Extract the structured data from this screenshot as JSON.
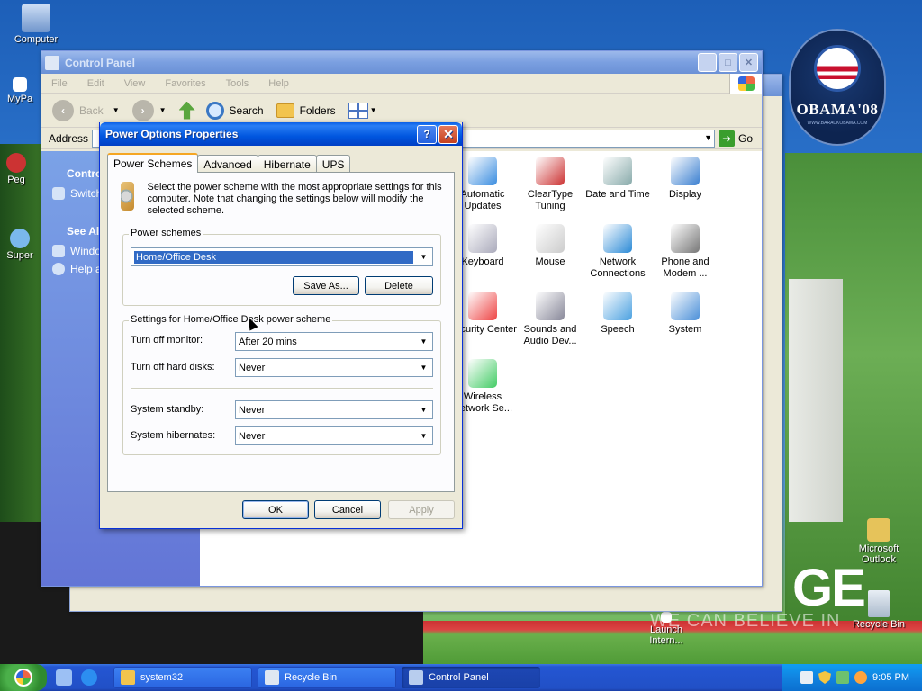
{
  "desktop": {
    "icons_left": [
      {
        "label": "Computer"
      },
      {
        "label": "MyPa"
      },
      {
        "label": "Peg"
      },
      {
        "label": "Super"
      }
    ],
    "icons_right": [
      {
        "label": "Microsoft Outlook"
      },
      {
        "label": "Recycle Bin"
      },
      {
        "label": "Launch Intern..."
      }
    ],
    "badge": {
      "text": "OBAMA'08",
      "sub": "WWW.BARACKOBAMA.COM"
    },
    "slogan_big": "GE",
    "slogan": "WE CAN BELIEVE IN"
  },
  "control_panel": {
    "title": "Control Panel",
    "menu": [
      "File",
      "Edit",
      "View",
      "Favorites",
      "Tools",
      "Help"
    ],
    "toolbar": {
      "back": "Back",
      "search": "Search",
      "folders": "Folders"
    },
    "address_label": "Address",
    "go_label": "Go",
    "sidebar": {
      "section1": "Contro",
      "link1": "Switch",
      "section2": "See Also",
      "link2": "Windo",
      "link3": "Help ar"
    },
    "icons": [
      {
        "label": "Automatic Updates",
        "color": "#3a8de0"
      },
      {
        "label": "ClearType Tuning",
        "color": "#c33"
      },
      {
        "label": "Date and Time",
        "color": "#8aa"
      },
      {
        "label": "Display",
        "color": "#3a7fd0"
      },
      {
        "label": "Keyboard",
        "color": "#aab"
      },
      {
        "label": "Mouse",
        "color": "#ccc"
      },
      {
        "label": "Network Connections",
        "color": "#2b8ad6"
      },
      {
        "label": "Phone and Modem ...",
        "color": "#777"
      },
      {
        "label": "Security Center",
        "color": "#e44"
      },
      {
        "label": "Sounds and Audio Dev...",
        "color": "#889"
      },
      {
        "label": "Speech",
        "color": "#4aa0e0"
      },
      {
        "label": "System",
        "color": "#4a8fd8"
      },
      {
        "label": "Wireless Network Se...",
        "color": "#4c6"
      }
    ]
  },
  "dialog": {
    "title": "Power Options Properties",
    "help_btn": "?",
    "close_btn": "✕",
    "tabs": [
      {
        "label": "Power Schemes",
        "active": true
      },
      {
        "label": "Advanced",
        "active": false
      },
      {
        "label": "Hibernate",
        "active": false
      },
      {
        "label": "UPS",
        "active": false
      }
    ],
    "intro": "Select the power scheme with the most appropriate settings for this computer. Note that changing the settings below will modify the selected scheme.",
    "schemes_group": "Power schemes",
    "scheme_value": "Home/Office Desk",
    "save_as": "Save As...",
    "delete": "Delete",
    "settings_group": "Settings for Home/Office Desk power scheme",
    "settings": [
      {
        "label": "Turn off monitor:",
        "value": "After 20 mins"
      },
      {
        "label": "Turn off hard disks:",
        "value": "Never"
      },
      {
        "label": "System standby:",
        "value": "Never"
      },
      {
        "label": "System hibernates:",
        "value": "Never"
      }
    ],
    "ok": "OK",
    "cancel": "Cancel",
    "apply": "Apply"
  },
  "taskbar": {
    "tasks": [
      {
        "label": "system32"
      },
      {
        "label": "Recycle Bin"
      },
      {
        "label": "Control Panel"
      }
    ],
    "clock": "9:05 PM"
  }
}
